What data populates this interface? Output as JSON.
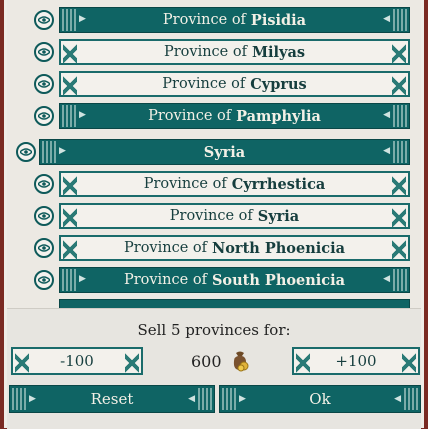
{
  "provinces": [
    {
      "prefix": "Province of",
      "name": "Pisidia",
      "style": "dark"
    },
    {
      "prefix": "Province of",
      "name": "Milyas",
      "style": "light"
    },
    {
      "prefix": "Province of",
      "name": "Cyprus",
      "style": "light"
    },
    {
      "prefix": "Province of",
      "name": "Pamphylia",
      "style": "dark"
    },
    {
      "prefix": "",
      "name": "Syria",
      "style": "dark"
    },
    {
      "prefix": "Province of",
      "name": "Cyrrhestica",
      "style": "light"
    },
    {
      "prefix": "Province of",
      "name": "Syria",
      "style": "light"
    },
    {
      "prefix": "Province of",
      "name": "North Phoenicia",
      "style": "light"
    },
    {
      "prefix": "Province of",
      "name": "South Phoenicia",
      "style": "dark"
    }
  ],
  "sell": {
    "label": "Sell 5 provinces for:",
    "minus_label": "-100",
    "plus_label": "+100",
    "price": "600"
  },
  "actions": {
    "reset_label": "Reset",
    "ok_label": "Ok"
  },
  "icons": {
    "visibility": "eye-icon",
    "currency": "money-bag-icon"
  },
  "colors": {
    "teal": "#0f6464",
    "parchment": "#ece9e3",
    "border_red": "#7a2a22"
  }
}
